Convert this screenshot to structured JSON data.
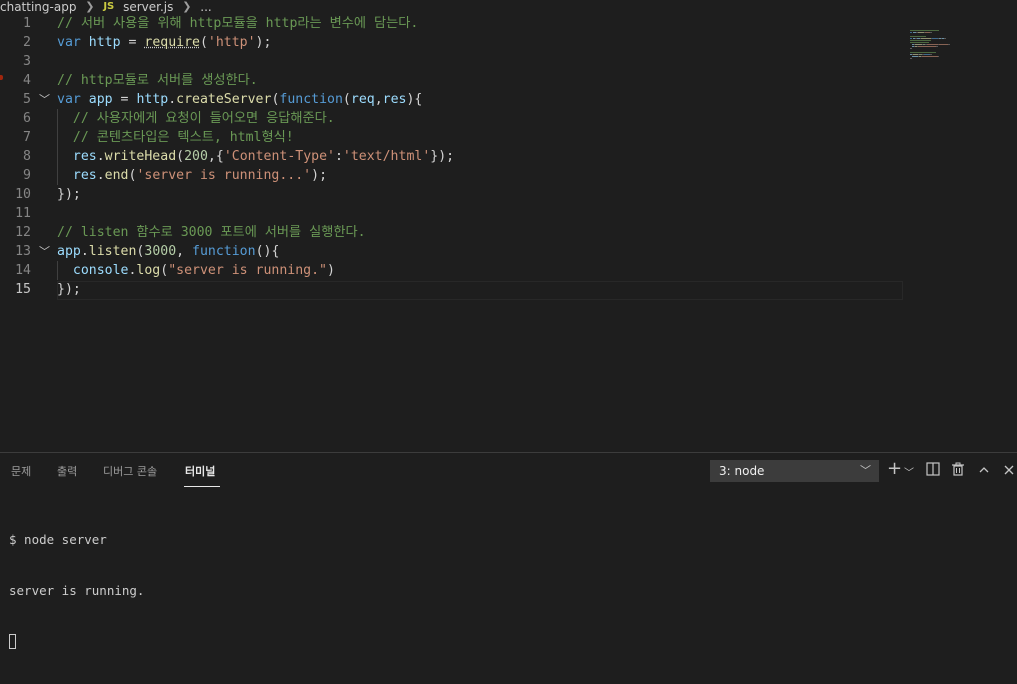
{
  "breadcrumb": {
    "folder": "chatting-app",
    "file_badge": "JS",
    "file": "server.js",
    "more": "..."
  },
  "editor": {
    "lines": [
      {
        "num": "1",
        "tokens": [
          {
            "t": "// 서버 사용을 위해 http모듈을 http라는 변수에 담는다.",
            "c": "cm"
          }
        ]
      },
      {
        "num": "2",
        "tokens": [
          {
            "t": "var",
            "c": "kw"
          },
          {
            "t": " ",
            "c": "pn"
          },
          {
            "t": "http",
            "c": "vr"
          },
          {
            "t": " = ",
            "c": "pn"
          },
          {
            "t": "require",
            "c": "fn"
          },
          {
            "t": "(",
            "c": "pn"
          },
          {
            "t": "'http'",
            "c": "str"
          },
          {
            "t": ");",
            "c": "pn"
          }
        ]
      },
      {
        "num": "3",
        "tokens": []
      },
      {
        "num": "4",
        "tokens": [
          {
            "t": "// http모듈로 서버를 생성한다.",
            "c": "cm"
          }
        ]
      },
      {
        "num": "5",
        "tokens": [
          {
            "t": "var",
            "c": "kw"
          },
          {
            "t": " ",
            "c": "pn"
          },
          {
            "t": "app",
            "c": "vr"
          },
          {
            "t": " = ",
            "c": "pn"
          },
          {
            "t": "http",
            "c": "vr"
          },
          {
            "t": ".",
            "c": "pn"
          },
          {
            "t": "createServer",
            "c": "fn"
          },
          {
            "t": "(",
            "c": "pn"
          },
          {
            "t": "function",
            "c": "kw"
          },
          {
            "t": "(",
            "c": "pn"
          },
          {
            "t": "req",
            "c": "vr"
          },
          {
            "t": ",",
            "c": "pn"
          },
          {
            "t": "res",
            "c": "vr"
          },
          {
            "t": "){",
            "c": "pn"
          }
        ]
      },
      {
        "num": "6",
        "tokens": [
          {
            "t": "  // 사용자에게 요청이 들어오면 응답해준다.",
            "c": "cm"
          }
        ]
      },
      {
        "num": "7",
        "tokens": [
          {
            "t": "  // 콘텐츠타입은 텍스트, html형식!",
            "c": "cm"
          }
        ]
      },
      {
        "num": "8",
        "tokens": [
          {
            "t": "  ",
            "c": "pn"
          },
          {
            "t": "res",
            "c": "vr"
          },
          {
            "t": ".",
            "c": "pn"
          },
          {
            "t": "writeHead",
            "c": "fn"
          },
          {
            "t": "(",
            "c": "pn"
          },
          {
            "t": "200",
            "c": "num"
          },
          {
            "t": ",{",
            "c": "pn"
          },
          {
            "t": "'Content-Type'",
            "c": "str"
          },
          {
            "t": ":",
            "c": "pn"
          },
          {
            "t": "'text/html'",
            "c": "str"
          },
          {
            "t": "});",
            "c": "pn"
          }
        ]
      },
      {
        "num": "9",
        "tokens": [
          {
            "t": "  ",
            "c": "pn"
          },
          {
            "t": "res",
            "c": "vr"
          },
          {
            "t": ".",
            "c": "pn"
          },
          {
            "t": "end",
            "c": "fn"
          },
          {
            "t": "(",
            "c": "pn"
          },
          {
            "t": "'server is running...'",
            "c": "str"
          },
          {
            "t": ");",
            "c": "pn"
          }
        ]
      },
      {
        "num": "10",
        "tokens": [
          {
            "t": "});",
            "c": "pn"
          }
        ]
      },
      {
        "num": "11",
        "tokens": []
      },
      {
        "num": "12",
        "tokens": [
          {
            "t": "// listen 함수로 3000 포트에 서버를 실행한다.",
            "c": "cm"
          }
        ]
      },
      {
        "num": "13",
        "tokens": [
          {
            "t": "app",
            "c": "vr"
          },
          {
            "t": ".",
            "c": "pn"
          },
          {
            "t": "listen",
            "c": "fn"
          },
          {
            "t": "(",
            "c": "pn"
          },
          {
            "t": "3000",
            "c": "num"
          },
          {
            "t": ", ",
            "c": "pn"
          },
          {
            "t": "function",
            "c": "kw"
          },
          {
            "t": "(){",
            "c": "pn"
          }
        ]
      },
      {
        "num": "14",
        "tokens": [
          {
            "t": "  ",
            "c": "pn"
          },
          {
            "t": "console",
            "c": "vr"
          },
          {
            "t": ".",
            "c": "pn"
          },
          {
            "t": "log",
            "c": "fn"
          },
          {
            "t": "(",
            "c": "pn"
          },
          {
            "t": "\"server is running.\"",
            "c": "str"
          },
          {
            "t": ")",
            "c": "pn"
          }
        ]
      },
      {
        "num": "15",
        "tokens": [
          {
            "t": "});",
            "c": "pn"
          }
        ]
      }
    ]
  },
  "panel": {
    "tabs": [
      "문제",
      "출력",
      "디버그 콘솔",
      "터미널"
    ],
    "active_tab": "터미널",
    "terminal_select": "3: node",
    "terminal_lines": [
      "$ node server",
      "server is running."
    ]
  },
  "colors": {
    "comment": "#6a9955",
    "keyword": "#569cd6",
    "variable": "#9cdcfe",
    "function": "#dcdcaa",
    "string": "#ce9178",
    "number": "#b5cea8",
    "breakpoint": "#a1260d"
  },
  "icons": [
    "chevron-right-icon",
    "js-file-icon",
    "fold-chevron-icon",
    "plus-icon",
    "split-icon",
    "trash-icon",
    "chevron-up-icon",
    "close-icon"
  ]
}
